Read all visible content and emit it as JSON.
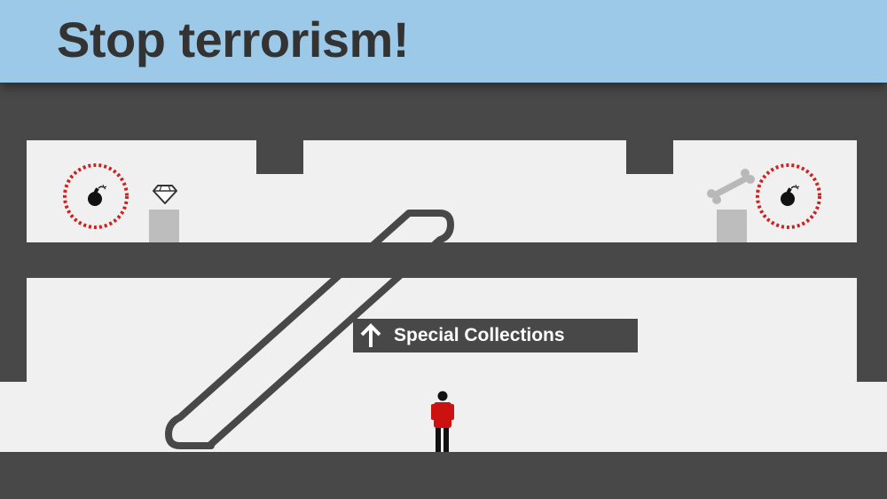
{
  "header": {
    "title": "Stop terrorism!"
  },
  "sign": {
    "label": "Special Collections",
    "icon": "arrow-up-icon"
  },
  "items": {
    "bomb_left": "bomb-icon",
    "bomb_right": "bomb-icon",
    "diamond": "diamond-icon",
    "bone": "bone-icon"
  },
  "colors": {
    "banner": "#9dc9e9",
    "title_text": "#333333",
    "wall": "#484848",
    "floor": "#f0f0f0",
    "pedestal": "#bdbdbd",
    "bomb_ring": "#cc2222",
    "player_shirt": "#cc1111",
    "player_legs": "#111111"
  }
}
